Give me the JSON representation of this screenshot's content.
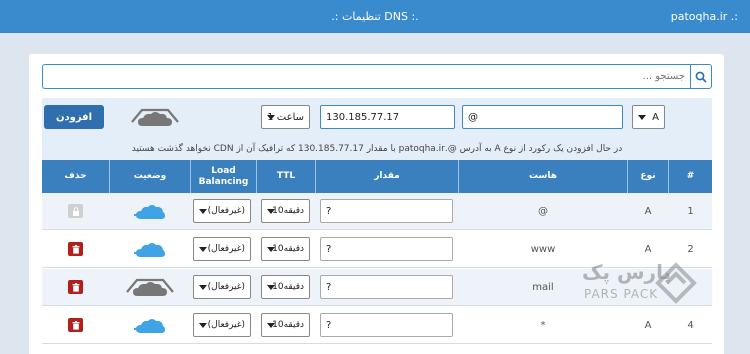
{
  "header": {
    "title": ".: تنظیمات DNS :.",
    "domain": "patoqha.ir .:"
  },
  "search": {
    "placeholder": "جستجو ..."
  },
  "add_row": {
    "add_label": "افزودن",
    "type_value": "A",
    "host_value": "@",
    "value_value": "130.185.77.17",
    "ttl_value": "1 ساعت"
  },
  "hint": "در حال افزودن یک رکورد از نوع A به آدرس @.patoqha.ir با مقدار 130.185.77.17 که ترافیک آن از CDN نخواهد گذشت هستید",
  "columns": {
    "num": "#",
    "type": "نوع",
    "host": "هاست",
    "value": "مقدار",
    "ttl": "TTL",
    "lb": "Load Balancing",
    "status": "وضعیت",
    "delete": "حذف"
  },
  "rows": [
    {
      "num": "1",
      "type": "A",
      "host": "@",
      "value": "?",
      "ttl": "10دقیقه",
      "lb": "(غیرفعال)",
      "cdn": "on",
      "deletable": false
    },
    {
      "num": "2",
      "type": "A",
      "host": "www",
      "value": "?",
      "ttl": "10دقیقه",
      "lb": "(غیرفعال)",
      "cdn": "on",
      "deletable": true
    },
    {
      "num": "",
      "type": "",
      "host": "mail",
      "value": "?",
      "ttl": "10دقیقه",
      "lb": "(غیرفعال)",
      "cdn": "off",
      "deletable": true
    },
    {
      "num": "4",
      "type": "A",
      "host": "*",
      "value": "?",
      "ttl": "10دقیقه",
      "lb": "(غیرفعال)",
      "cdn": "on",
      "deletable": true
    }
  ],
  "watermark": {
    "line1": "پارس پک",
    "line2": "PARS PACK"
  },
  "colors": {
    "primary": "#3a8bcd",
    "header": "#3a7fbe",
    "delete": "#b3201b",
    "cloud_on": "#3fa3e6",
    "cloud_off": "#777777"
  }
}
